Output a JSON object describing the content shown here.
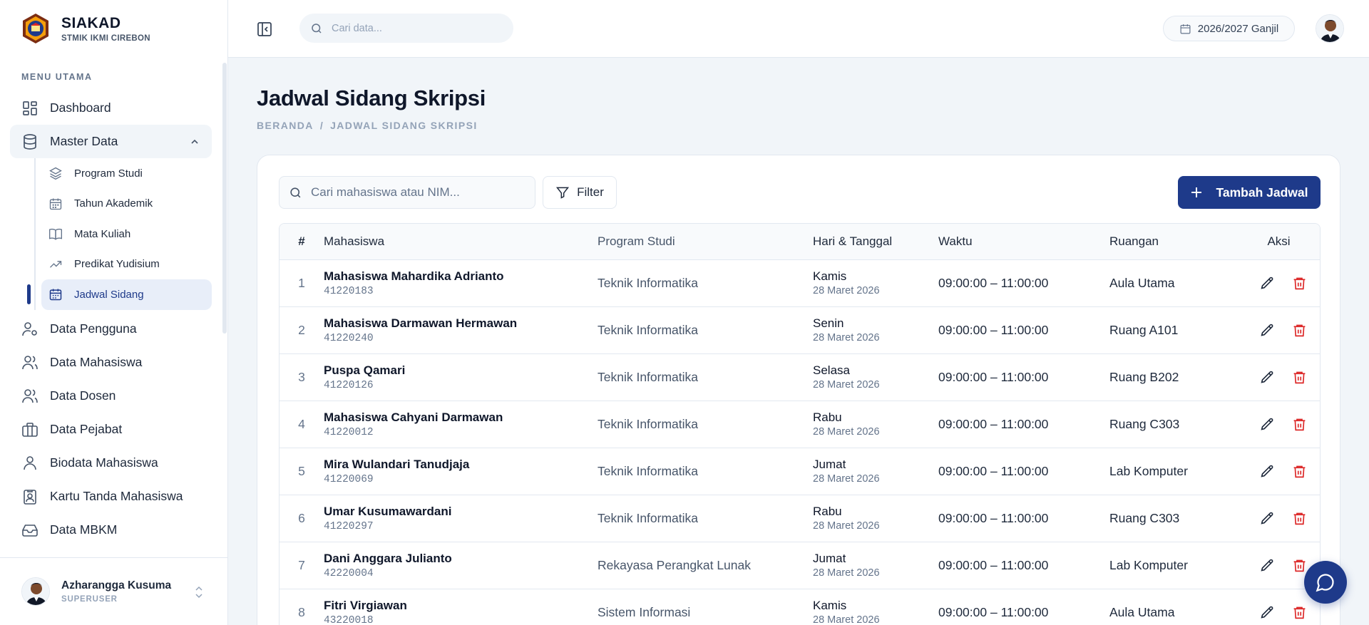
{
  "brand": {
    "title": "SIAKAD",
    "subtitle": "STMIK IKMI CIREBON"
  },
  "menu_heading": "MENU UTAMA",
  "nav": {
    "dashboard": "Dashboard",
    "master_data": "Master Data",
    "sub": [
      {
        "label": "Program Studi",
        "icon": "layers-icon"
      },
      {
        "label": "Tahun Akademik",
        "icon": "calendar-icon"
      },
      {
        "label": "Mata Kuliah",
        "icon": "book-icon"
      },
      {
        "label": "Predikat Yudisium",
        "icon": "trending-icon"
      },
      {
        "label": "Jadwal Sidang",
        "icon": "calendar-days-icon",
        "active": true
      }
    ],
    "items": [
      {
        "label": "Data Pengguna",
        "icon": "user-cog-icon"
      },
      {
        "label": "Data Mahasiswa",
        "icon": "users-icon"
      },
      {
        "label": "Data Dosen",
        "icon": "users-icon"
      },
      {
        "label": "Data Pejabat",
        "icon": "briefcase-icon"
      },
      {
        "label": "Biodata Mahasiswa",
        "icon": "user-icon"
      },
      {
        "label": "Kartu Tanda Mahasiswa",
        "icon": "id-card-icon"
      },
      {
        "label": "Data MBKM",
        "icon": "inbox-icon"
      }
    ]
  },
  "user": {
    "name": "Azharangga Kusuma",
    "role": "SUPERUSER"
  },
  "header": {
    "search_placeholder": "Cari data...",
    "period": "2026/2027 Ganjil"
  },
  "page": {
    "title": "Jadwal Sidang Skripsi",
    "breadcrumb": [
      "BERANDA",
      "/",
      "JADWAL SIDANG SKRIPSI"
    ]
  },
  "toolbar": {
    "search_placeholder": "Cari mahasiswa atau NIM...",
    "filter_label": "Filter",
    "add_label": "Tambah Jadwal"
  },
  "table": {
    "columns": [
      "#",
      "Mahasiswa",
      "Program Studi",
      "Hari & Tanggal",
      "Waktu",
      "Ruangan",
      "Aksi"
    ],
    "rows": [
      {
        "no": "1",
        "name": "Mahasiswa Mahardika Adrianto",
        "nim": "41220183",
        "prodi": "Teknik Informatika",
        "day": "Kamis",
        "date": "28 Maret 2026",
        "time": "09:00:00 – 11:00:00",
        "room": "Aula Utama"
      },
      {
        "no": "2",
        "name": "Mahasiswa Darmawan Hermawan",
        "nim": "41220240",
        "prodi": "Teknik Informatika",
        "day": "Senin",
        "date": "28 Maret 2026",
        "time": "09:00:00 – 11:00:00",
        "room": "Ruang A101"
      },
      {
        "no": "3",
        "name": "Puspa Qamari",
        "nim": "41220126",
        "prodi": "Teknik Informatika",
        "day": "Selasa",
        "date": "28 Maret 2026",
        "time": "09:00:00 – 11:00:00",
        "room": "Ruang B202"
      },
      {
        "no": "4",
        "name": "Mahasiswa Cahyani Darmawan",
        "nim": "41220012",
        "prodi": "Teknik Informatika",
        "day": "Rabu",
        "date": "28 Maret 2026",
        "time": "09:00:00 – 11:00:00",
        "room": "Ruang C303"
      },
      {
        "no": "5",
        "name": "Mira Wulandari Tanudjaja",
        "nim": "41220069",
        "prodi": "Teknik Informatika",
        "day": "Jumat",
        "date": "28 Maret 2026",
        "time": "09:00:00 – 11:00:00",
        "room": "Lab Komputer"
      },
      {
        "no": "6",
        "name": "Umar Kusumawardani",
        "nim": "41220297",
        "prodi": "Teknik Informatika",
        "day": "Rabu",
        "date": "28 Maret 2026",
        "time": "09:00:00 – 11:00:00",
        "room": "Ruang C303"
      },
      {
        "no": "7",
        "name": "Dani Anggara Julianto",
        "nim": "42220004",
        "prodi": "Rekayasa Perangkat Lunak",
        "day": "Jumat",
        "date": "28 Maret 2026",
        "time": "09:00:00 – 11:00:00",
        "room": "Lab Komputer"
      },
      {
        "no": "8",
        "name": "Fitri Virgiawan",
        "nim": "43220018",
        "prodi": "Sistem Informasi",
        "day": "Kamis",
        "date": "28 Maret 2026",
        "time": "09:00:00 – 11:00:00",
        "room": "Aula Utama"
      }
    ]
  },
  "colors": {
    "primary": "#1e3a8a",
    "danger": "#dc2626",
    "background": "#f1f5f9"
  }
}
